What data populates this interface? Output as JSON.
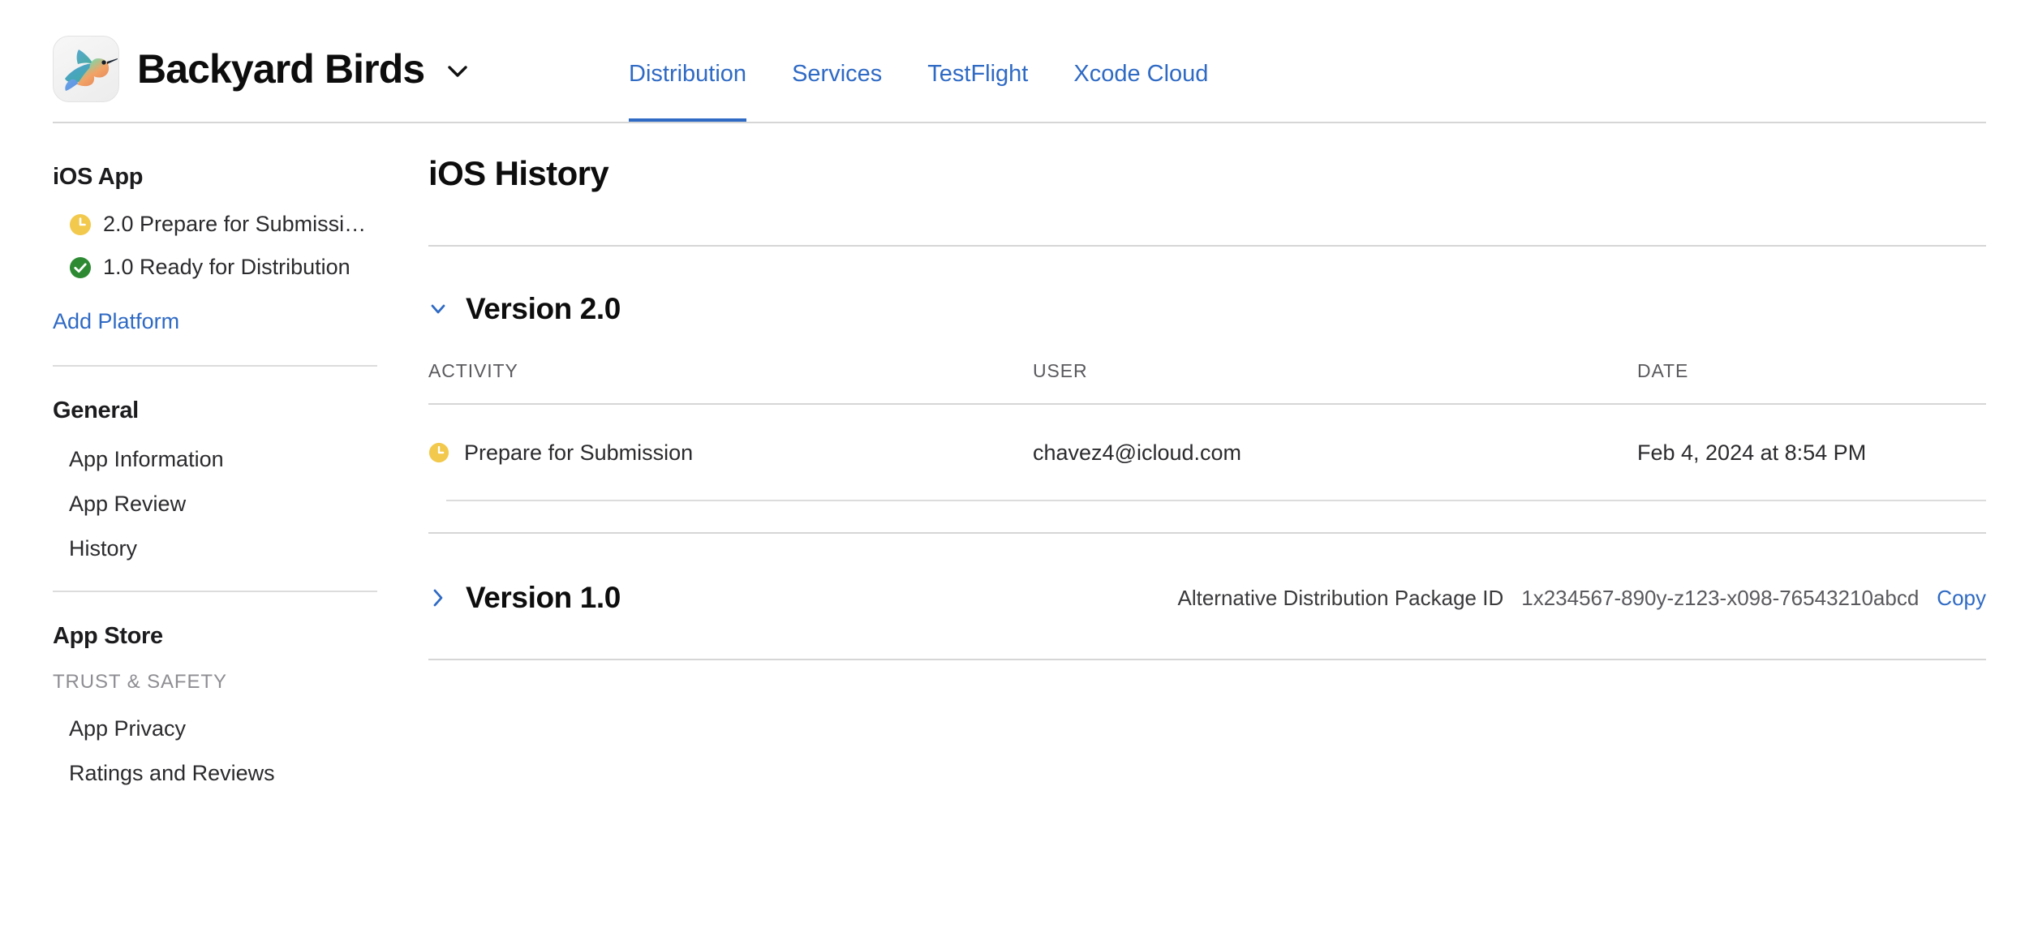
{
  "header": {
    "app_name": "Backyard Birds",
    "app_icon": "hummingbird-app-icon",
    "app_menu_chevron": "chevron-down-icon",
    "tabs": [
      {
        "label": "Distribution",
        "active": true
      },
      {
        "label": "Services",
        "active": false
      },
      {
        "label": "TestFlight",
        "active": false
      },
      {
        "label": "Xcode Cloud",
        "active": false
      }
    ]
  },
  "sidebar": {
    "platform_heading": "iOS App",
    "versions": [
      {
        "label": "2.0 Prepare for Submissi…",
        "status_icon": "clock-icon",
        "status_color": "#f2c94c"
      },
      {
        "label": "1.0 Ready for Distribution",
        "status_icon": "check-circle-icon",
        "status_color": "#2d8a33"
      }
    ],
    "add_platform_label": "Add Platform",
    "general_heading": "General",
    "general_items": [
      {
        "label": "App Information"
      },
      {
        "label": "App Review"
      },
      {
        "label": "History"
      }
    ],
    "app_store_heading": "App Store",
    "trust_safety_label": "TRUST & SAFETY",
    "trust_safety_items": [
      {
        "label": "App Privacy"
      },
      {
        "label": "Ratings and Reviews"
      }
    ]
  },
  "main": {
    "title": "iOS History",
    "columns": {
      "activity": "ACTIVITY",
      "user": "USER",
      "date": "DATE"
    },
    "versions": [
      {
        "title": "Version 2.0",
        "expanded": true,
        "chevron": "chevron-down-icon",
        "rows": [
          {
            "activity": "Prepare for Submission",
            "status_icon": "clock-icon",
            "status_color": "#f2c94c",
            "user": "chavez4@icloud.com",
            "date": "Feb 4, 2024 at 8:54 PM"
          }
        ]
      },
      {
        "title": "Version 1.0",
        "expanded": false,
        "chevron": "chevron-right-icon",
        "package_label": "Alternative Distribution Package ID",
        "package_id": "1x234567-890y-z123-x098-76543210abcd",
        "copy_label": "Copy"
      }
    ]
  },
  "colors": {
    "accent_blue": "#2f6ac4",
    "warning_yellow": "#f2c94c",
    "success_green": "#2d8a33",
    "text_primary": "#0d0d0d",
    "text_secondary": "#5a5a5e",
    "divider": "#d6d6d6"
  }
}
